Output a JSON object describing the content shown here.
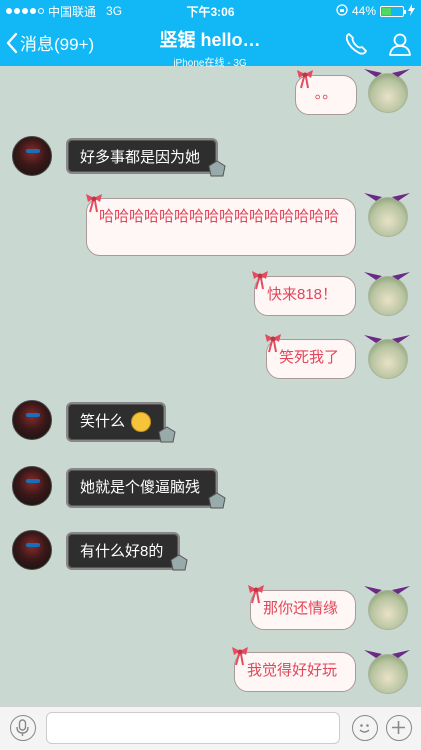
{
  "status": {
    "carrier": "中国联通",
    "network": "3G",
    "time": "下午3:06",
    "battery_pct": "44%",
    "battery_fraction": 0.44
  },
  "nav": {
    "back_label": "消息(99+)",
    "title": "竖锯 hello…",
    "subtitle": "iPhone在线 - 3G"
  },
  "messages": [
    {
      "side": "right",
      "text": "。。"
    },
    {
      "side": "left",
      "text": "好多事都是因为她"
    },
    {
      "side": "right",
      "text": "哈哈哈哈哈哈哈哈哈哈哈哈哈哈哈哈"
    },
    {
      "side": "right",
      "text": "快来818！"
    },
    {
      "side": "right",
      "text": "笑死我了"
    },
    {
      "side": "left",
      "text": "笑什么"
    },
    {
      "side": "left",
      "text": "她就是个傻逼脑残"
    },
    {
      "side": "left",
      "text": "有什么好8的"
    },
    {
      "side": "right",
      "text": "那你还情缘"
    },
    {
      "side": "right",
      "text": "我觉得好好玩"
    }
  ],
  "colors": {
    "header": "#12b7f5",
    "chat_bg": "#c9d8d0",
    "pink_text": "#e2475a"
  }
}
